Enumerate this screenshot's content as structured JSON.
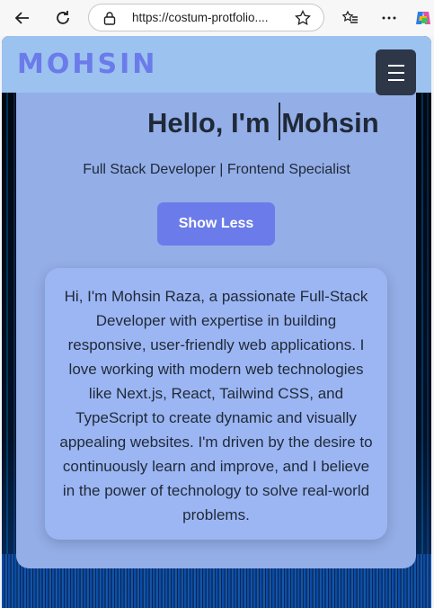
{
  "browser": {
    "url": "https://costum-protfolio....",
    "icons": [
      "back-arrow-icon",
      "reload-icon",
      "lock-icon",
      "star-icon",
      "favorites-icon",
      "more-icon",
      "copilot-icon"
    ]
  },
  "nav": {
    "logo": "MOHSIN",
    "menu_icon": "hamburger-menu-icon"
  },
  "hero": {
    "greeting_prefix": "Hello, I'm ",
    "name": "Mohsin",
    "subtitle": "Full Stack Developer | Frontend Specialist",
    "toggle_label": "Show Less"
  },
  "about": {
    "text": "Hi, I'm Mohsin Raza, a passionate Full-Stack Developer with expertise in building responsive, user-friendly web applications. I love working with modern web technologies like Next.js, React, Tailwind CSS, and TypeScript to create dynamic and visually appealing websites. I'm driven by the desire to continuously learn and improve, and I believe in the power of technology to solve real-world problems."
  },
  "colors": {
    "accent": "#6b7be9",
    "navbar": "#9cc2f0",
    "card": "#94aee8",
    "menu_button": "#2d3748"
  }
}
